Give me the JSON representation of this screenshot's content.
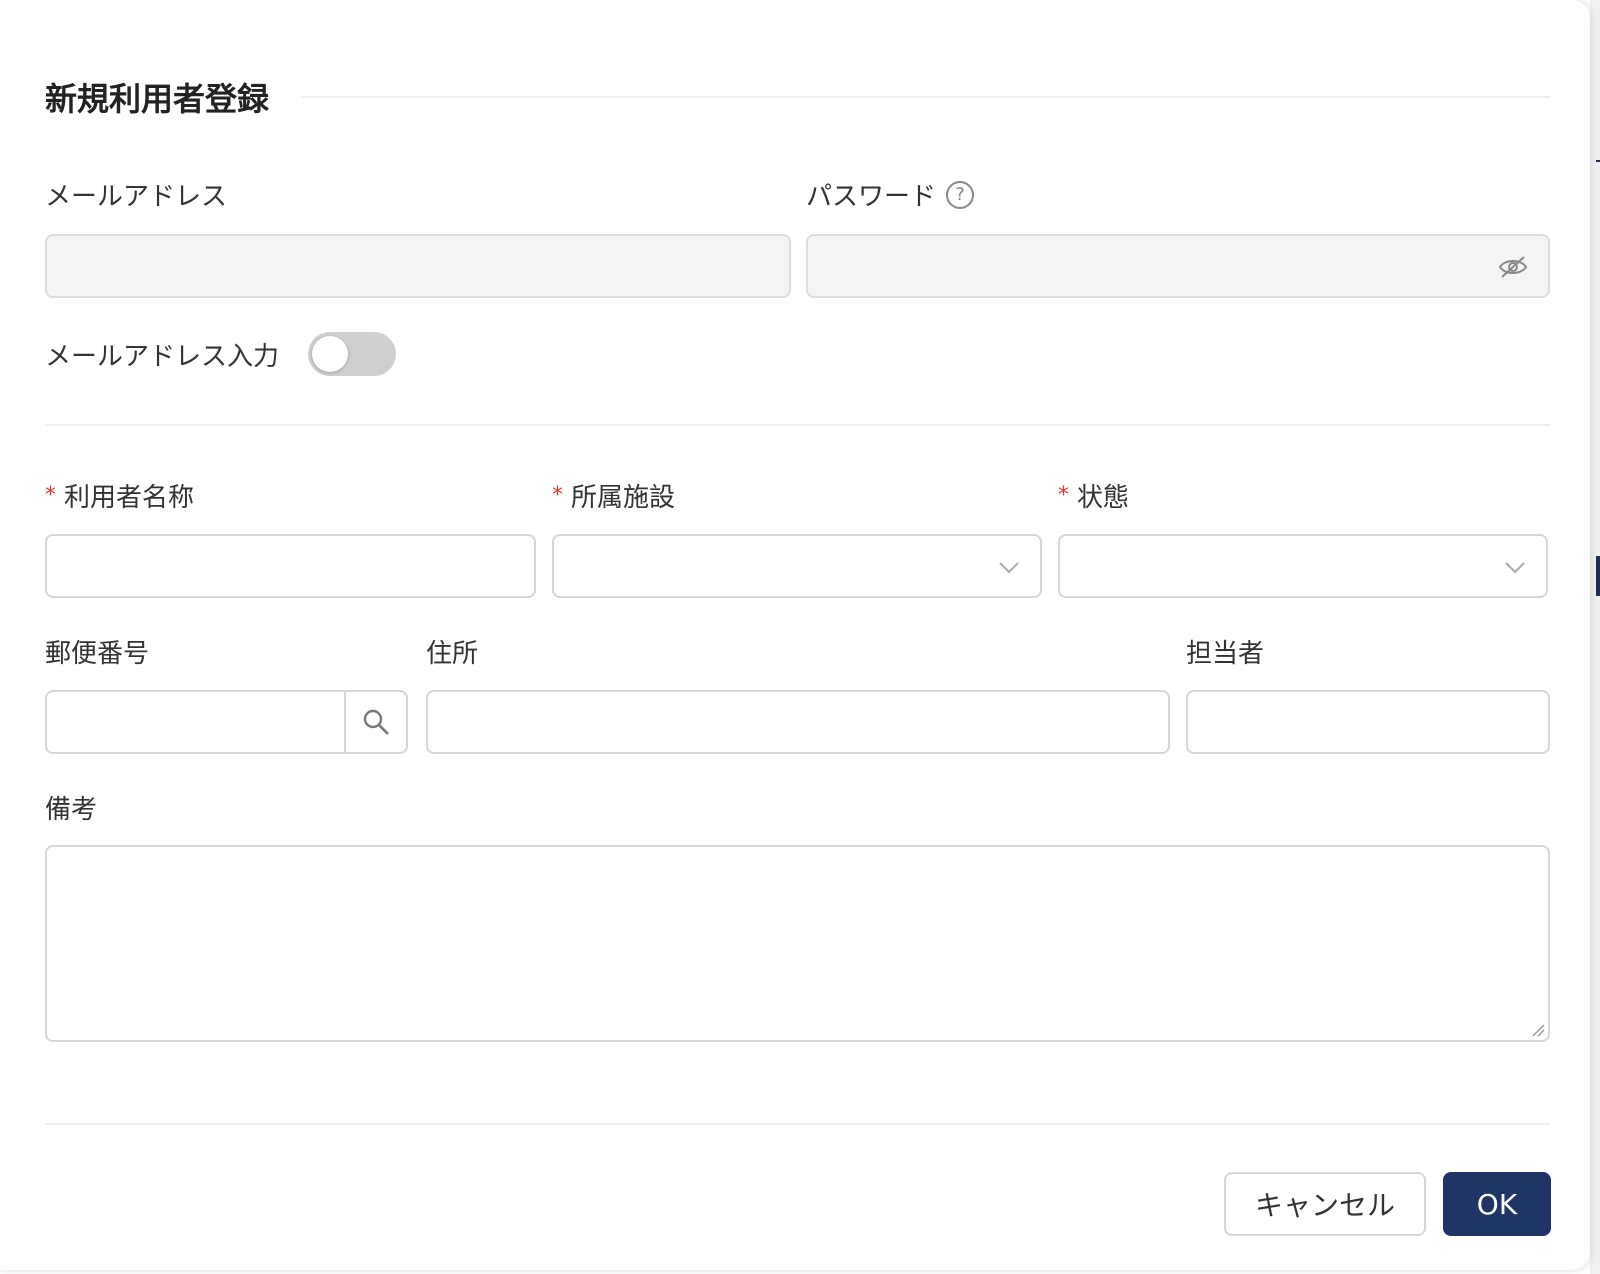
{
  "dialog": {
    "title": "新規利用者登録"
  },
  "email": {
    "label": "メールアドレス",
    "value": ""
  },
  "password": {
    "label": "パスワード",
    "help_glyph": "?",
    "value": ""
  },
  "email_input_toggle": {
    "label": "メールアドレス入力",
    "on": false
  },
  "user_name": {
    "required_mark": "*",
    "label": "利用者名称",
    "value": ""
  },
  "facility": {
    "required_mark": "*",
    "label": "所属施設",
    "value": ""
  },
  "status": {
    "required_mark": "*",
    "label": "状態",
    "value": ""
  },
  "postal_code": {
    "label": "郵便番号",
    "value": ""
  },
  "address": {
    "label": "住所",
    "value": ""
  },
  "person_in_charge": {
    "label": "担当者",
    "value": ""
  },
  "notes": {
    "label": "備考",
    "value": ""
  },
  "footer": {
    "cancel_label": "キャンセル",
    "ok_label": "OK"
  },
  "icons": {
    "password_visibility": "eye-slash-icon",
    "help": "question-circle-icon",
    "search": "search-icon",
    "select_arrow": "chevron-down-icon"
  },
  "colors": {
    "primary": "#1f3566",
    "required": "#e53935",
    "toggle_off": "#cfcfcf",
    "disabled_field": "#f4f4f4"
  }
}
